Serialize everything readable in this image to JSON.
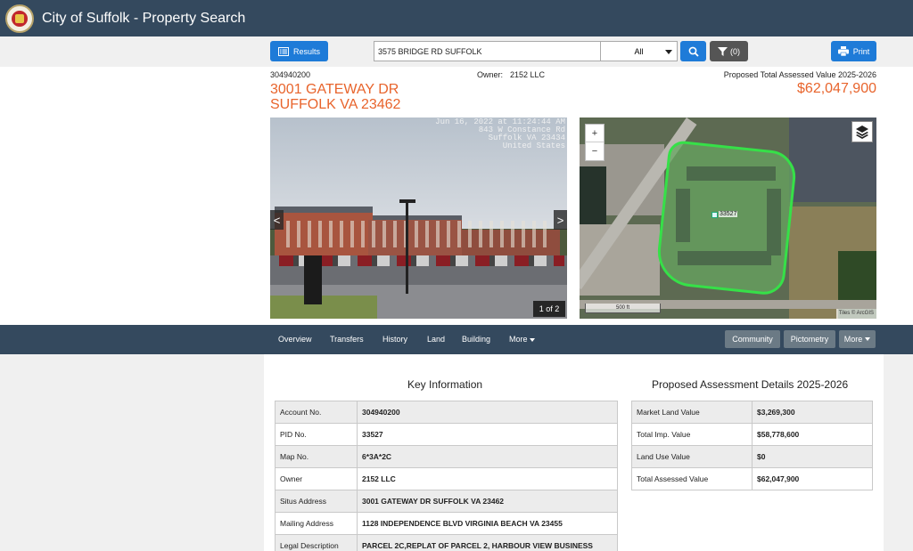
{
  "header": {
    "title": "City of Suffolk - Property Search"
  },
  "toolbar": {
    "results_label": "Results",
    "search_value": "3575 BRIDGE RD SUFFOLK",
    "scope_value": "All",
    "filter_label": "(0)",
    "print_label": "Print"
  },
  "summary": {
    "account_no": "304940200",
    "owner_label": "Owner:",
    "owner_value": "2152 LLC",
    "address_line1": "3001 GATEWAY DR",
    "address_line2": "SUFFOLK VA 23462",
    "value_label": "Proposed Total Assessed Value 2025-2026",
    "value_amount": "$62,047,900"
  },
  "photo": {
    "stamp_line1": "Jun 16, 2022 at 11:24:44 AM",
    "stamp_line2": "843 W Constance Rd",
    "stamp_line3": "Suffolk VA 23434",
    "stamp_line4": "United States",
    "prev": "<",
    "next": ">",
    "counter": "1 of 2"
  },
  "map": {
    "zoom_in": "+",
    "zoom_out": "−",
    "parcel_label": "33527",
    "scale_label": "500 ft",
    "attribution": "Tiles © ArcGIS"
  },
  "tabs": {
    "overview": "Overview",
    "transfers": "Transfers",
    "history": "History",
    "land": "Land",
    "building": "Building",
    "more": "More",
    "community": "Community",
    "pictometry": "Pictometry",
    "more_right": "More"
  },
  "key_info": {
    "title": "Key Information",
    "rows": [
      {
        "label": "Account No.",
        "value": "304940200"
      },
      {
        "label": "PID No.",
        "value": "33527"
      },
      {
        "label": "Map No.",
        "value": "6*3A*2C"
      },
      {
        "label": "Owner",
        "value": "2152 LLC"
      },
      {
        "label": "Situs Address",
        "value": "3001 GATEWAY DR SUFFOLK VA 23462"
      },
      {
        "label": "Mailing Address",
        "value": "1128 INDEPENDENCE BLVD VIRGINIA BEACH VA 23455"
      },
      {
        "label": "Legal Description",
        "value": "PARCEL 2C,REPLAT OF PARCEL 2, HARBOUR VIEW BUSINESS"
      }
    ]
  },
  "assessment": {
    "title": "Proposed Assessment Details 2025-2026",
    "rows": [
      {
        "label": "Market Land Value",
        "value": "$3,269,300"
      },
      {
        "label": "Total Imp. Value",
        "value": "$58,778,600"
      },
      {
        "label": "Land Use Value",
        "value": "$0"
      },
      {
        "label": "Total Assessed Value",
        "value": "$62,047,900"
      }
    ]
  },
  "colors": {
    "header_bg": "#34495e",
    "accent_orange": "#e8642c",
    "button_blue": "#1e7bd8"
  }
}
